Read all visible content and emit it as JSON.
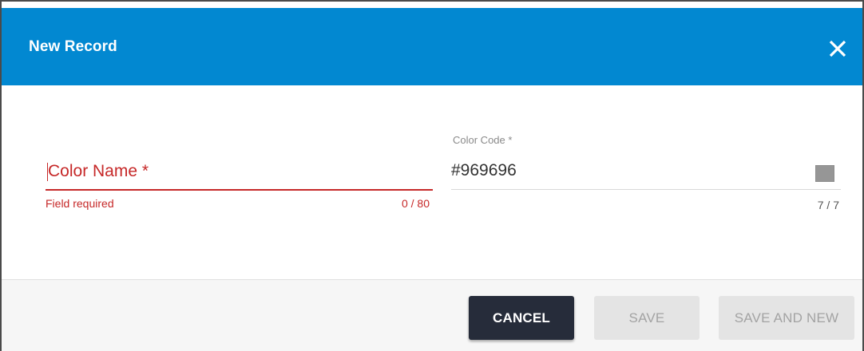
{
  "dialog": {
    "title": "New Record",
    "close_icon": "close-icon"
  },
  "form": {
    "color_name": {
      "placeholder": "Color Name *",
      "value": "",
      "helper_text": "Field required",
      "counter": "0 / 80"
    },
    "color_code": {
      "label": "Color Code *",
      "value": "#969696",
      "counter": "7 / 7",
      "swatch_color": "#969696"
    }
  },
  "footer": {
    "cancel_label": "CANCEL",
    "save_label": "SAVE",
    "save_and_new_label": "SAVE AND NEW"
  },
  "colors": {
    "header": "#0288d1",
    "error": "#c62828",
    "primary_button": "#262c3a"
  }
}
